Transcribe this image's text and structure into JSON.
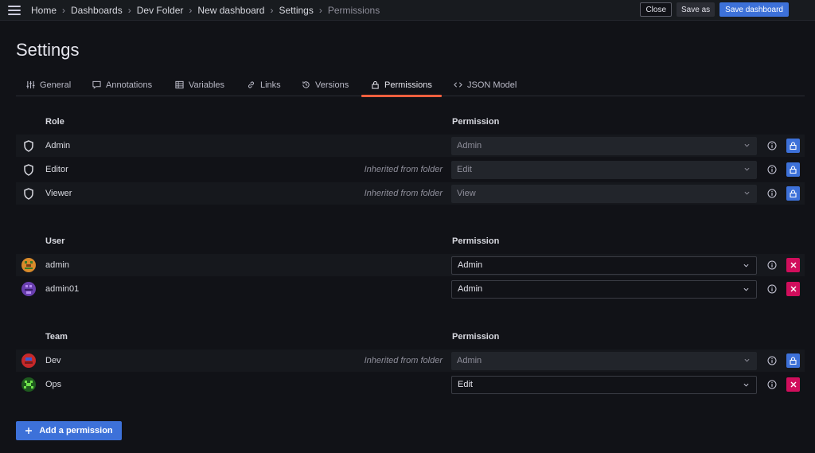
{
  "breadcrumbs": [
    "Home",
    "Dashboards",
    "Dev Folder",
    "New dashboard",
    "Settings",
    "Permissions"
  ],
  "actions": {
    "close": "Close",
    "save_as": "Save as",
    "save_dashboard": "Save dashboard"
  },
  "title": "Settings",
  "tabs": [
    "General",
    "Annotations",
    "Variables",
    "Links",
    "Versions",
    "Permissions",
    "JSON Model"
  ],
  "active_tab": "Permissions",
  "roles": {
    "header": "Role",
    "permission_header": "Permission",
    "rows": [
      {
        "name": "Admin",
        "inherited": "",
        "permission": "Admin"
      },
      {
        "name": "Editor",
        "inherited": "Inherited from folder",
        "permission": "Edit"
      },
      {
        "name": "Viewer",
        "inherited": "Inherited from folder",
        "permission": "View"
      }
    ]
  },
  "users": {
    "header": "User",
    "permission_header": "Permission",
    "rows": [
      {
        "name": "admin",
        "inherited": "",
        "permission": "Admin"
      },
      {
        "name": "admin01",
        "inherited": "",
        "permission": "Admin"
      }
    ]
  },
  "teams": {
    "header": "Team",
    "permission_header": "Permission",
    "rows": [
      {
        "name": "Dev",
        "inherited": "Inherited from folder",
        "permission": "Admin"
      },
      {
        "name": "Ops",
        "inherited": "",
        "permission": "Edit"
      }
    ]
  },
  "add_permission": "Add a permission",
  "colors": {
    "primary": "#3d71d9",
    "danger": "#d10e5c",
    "tab_indicator": "#f55f3e",
    "background": "#111217"
  }
}
